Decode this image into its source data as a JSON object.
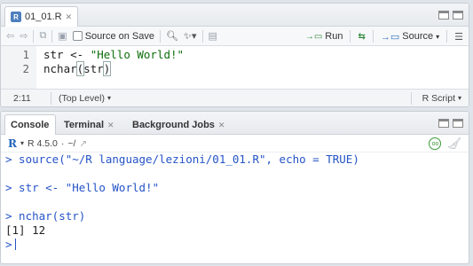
{
  "editor": {
    "tab": {
      "title": "01_01.R",
      "icon_label": "R"
    },
    "toolbar": {
      "source_on_save_label": "Source on Save",
      "run_label": "Run",
      "source_label": "Source"
    },
    "code_lines": [
      {
        "number": "1",
        "text_prefix": "str <- ",
        "text_string": "\"Hello World!\""
      },
      {
        "number": "2",
        "text_a": "nchar",
        "text_b": "(",
        "text_c": "str",
        "text_d": ")"
      }
    ],
    "status": {
      "position": "2:11",
      "scope": "(Top Level)",
      "file_type": "R Script"
    }
  },
  "console": {
    "tabs": [
      {
        "label": "Console"
      },
      {
        "label": "Terminal"
      },
      {
        "label": "Background Jobs"
      }
    ],
    "r_version": "R 4.5.0",
    "working_dir": "~/",
    "lines": [
      "> source(\"~/R language/lezioni/01_01.R\", echo = TRUE)",
      "",
      "> str <- \"Hello World!\"",
      "",
      "> nchar(str)",
      "[1] 12"
    ],
    "prompt": ">"
  }
}
